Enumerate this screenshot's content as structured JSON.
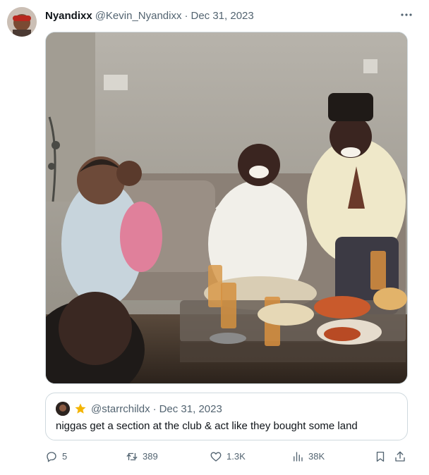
{
  "tweet": {
    "display_name": "Nyandixx",
    "handle": "@Kevin_Nyandixx",
    "separator": "·",
    "date": "Dec 31, 2023",
    "avatar_icon": "user-avatar",
    "more_icon": "more-horizontal-icon"
  },
  "quoted_tweet": {
    "handle": "@starrchildx",
    "separator": "·",
    "date": "Dec 31, 2023",
    "badge_icon": "star-badge-icon",
    "text": "niggas get a section at the club & act like they bought some land"
  },
  "actions": {
    "replies": "5",
    "retweets": "389",
    "likes": "1.3K",
    "views": "38K"
  },
  "colors": {
    "text_primary": "#0f1419",
    "text_secondary": "#536471",
    "border": "#cfd9de",
    "badge": "#f4b400"
  }
}
